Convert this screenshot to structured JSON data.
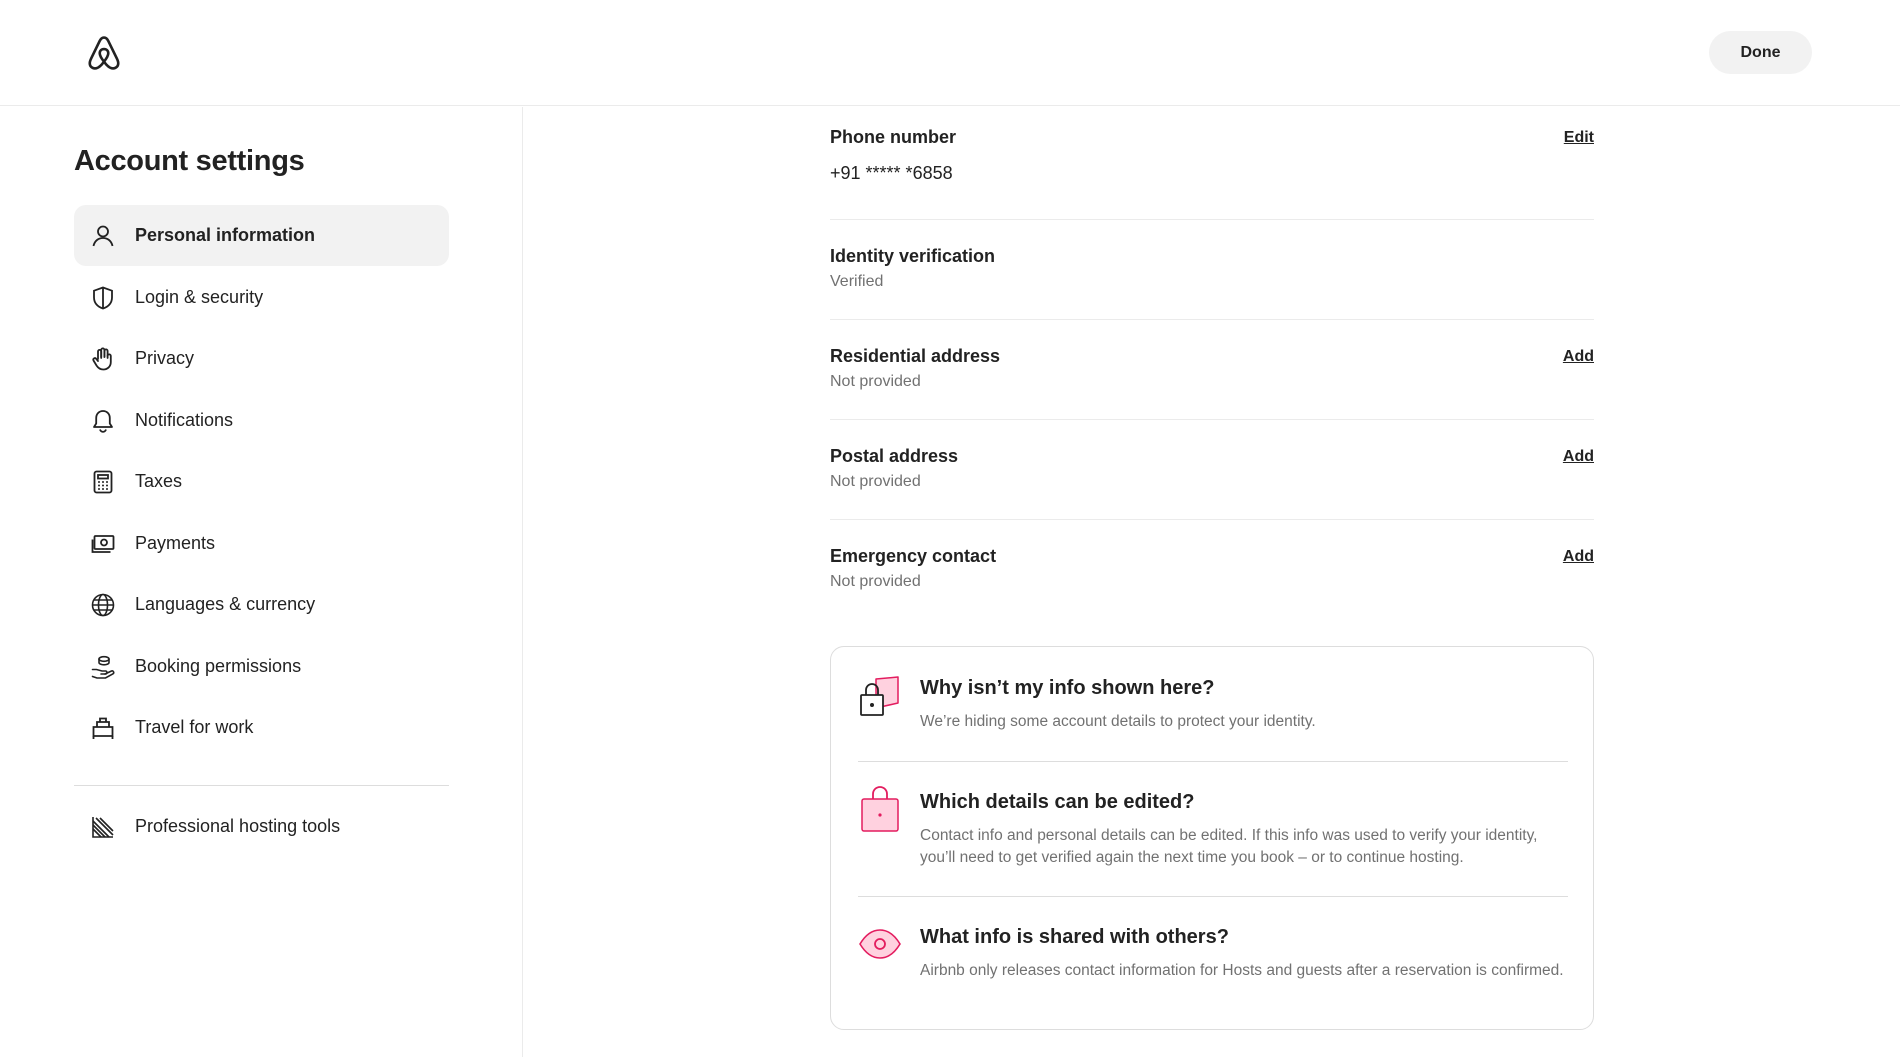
{
  "header": {
    "logo": "airbnb-logo-icon",
    "done_label": "Done"
  },
  "sidebar": {
    "title": "Account settings",
    "items": [
      {
        "label": "Personal information",
        "icon": "person-icon",
        "active": true
      },
      {
        "label": "Login & security",
        "icon": "shield-icon"
      },
      {
        "label": "Privacy",
        "icon": "hand-icon"
      },
      {
        "label": "Notifications",
        "icon": "bell-icon"
      },
      {
        "label": "Taxes",
        "icon": "calculator-icon"
      },
      {
        "label": "Payments",
        "icon": "cash-icon"
      },
      {
        "label": "Languages & currency",
        "icon": "globe-icon"
      },
      {
        "label": "Booking permissions",
        "icon": "hand-coins-icon"
      },
      {
        "label": "Travel for work",
        "icon": "suitcase-icon"
      }
    ],
    "extra_items": [
      {
        "label": "Professional hosting tools",
        "icon": "chart-stripes-icon"
      }
    ]
  },
  "main": {
    "rows": [
      {
        "label": "Phone number",
        "value": "+91 ***** *6858",
        "action": "Edit"
      },
      {
        "label": "Identity verification",
        "value": "Verified",
        "action": ""
      },
      {
        "label": "Residential address",
        "value": "Not provided",
        "action": "Add"
      },
      {
        "label": "Postal address",
        "value": "Not provided",
        "action": "Add"
      },
      {
        "label": "Emergency contact",
        "value": "Not provided",
        "action": "Add"
      }
    ],
    "info_card": [
      {
        "title": "Why isn’t my info shown here?",
        "text": "We’re hiding some account details to protect your identity.",
        "icon": "lock-icon"
      },
      {
        "title": "Which details can be edited?",
        "text": "Contact info and personal details can be edited. If this info was used to verify your identity, you’ll need to get verified again the next time you book – or to continue hosting.",
        "icon": "shopping-bag-icon"
      },
      {
        "title": "What info is shared with others?",
        "text": "Airbnb only releases contact information for Hosts and guests after a reservation is confirmed.",
        "icon": "eye-icon"
      }
    ]
  },
  "colors": {
    "accent": "#E31C5F",
    "accent_light": "#FFD1DF",
    "text": "#222222",
    "muted": "#717171",
    "border": "#DDDDDD"
  }
}
